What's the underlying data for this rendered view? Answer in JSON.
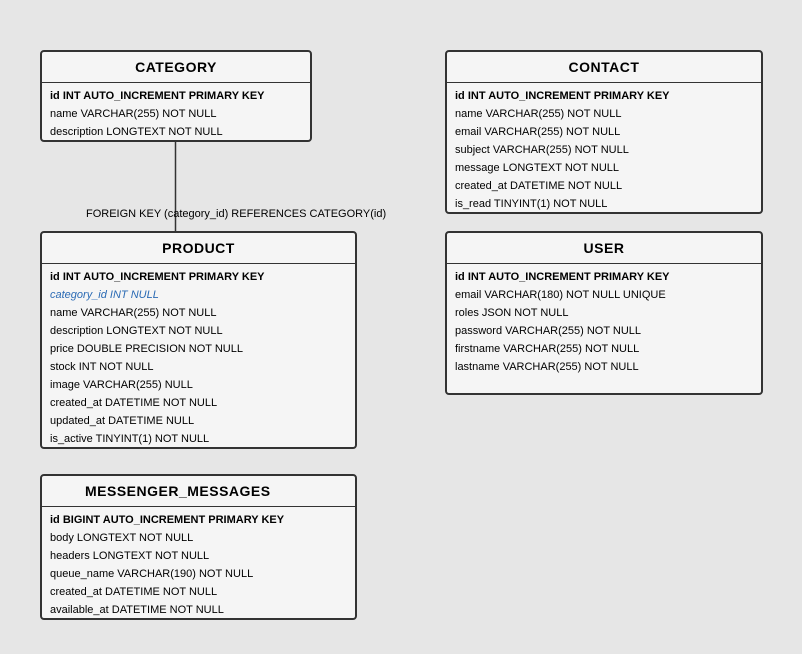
{
  "tables": {
    "category": {
      "name": "CATEGORY",
      "columns": [
        "id INT AUTO_INCREMENT PRIMARY KEY",
        "name VARCHAR(255) NOT NULL",
        "description LONGTEXT NOT NULL"
      ]
    },
    "contact": {
      "name": "CONTACT",
      "columns": [
        "id INT AUTO_INCREMENT PRIMARY KEY",
        "name VARCHAR(255) NOT NULL",
        "email VARCHAR(255) NOT NULL",
        "subject VARCHAR(255) NOT NULL",
        "message LONGTEXT NOT NULL",
        "created_at DATETIME NOT NULL",
        "is_read TINYINT(1) NOT NULL"
      ]
    },
    "product": {
      "name": "PRODUCT",
      "columns": [
        "id INT AUTO_INCREMENT PRIMARY KEY",
        "category_id INT NULL",
        "name VARCHAR(255) NOT NULL",
        "description LONGTEXT NOT NULL",
        "price DOUBLE PRECISION NOT NULL",
        "stock INT NOT NULL",
        "image VARCHAR(255) NULL",
        "created_at DATETIME NOT NULL",
        "updated_at DATETIME NULL",
        "is_active TINYINT(1) NOT NULL"
      ]
    },
    "user": {
      "name": "USER",
      "columns": [
        "id INT AUTO_INCREMENT PRIMARY KEY",
        "email VARCHAR(180) NOT NULL UNIQUE",
        "roles JSON NOT NULL",
        "password VARCHAR(255) NOT NULL",
        "firstname VARCHAR(255) NOT NULL",
        "lastname VARCHAR(255) NOT NULL"
      ]
    },
    "messenger_messages": {
      "name": "MESSENGER_MESSAGES",
      "columns": [
        "id BIGINT AUTO_INCREMENT PRIMARY KEY",
        "body LONGTEXT NOT NULL",
        "headers LONGTEXT NOT NULL",
        "queue_name VARCHAR(190) NOT NULL",
        "created_at DATETIME NOT NULL",
        "available_at DATETIME NOT NULL"
      ]
    }
  },
  "relations": [
    {
      "label": "FOREIGN KEY (category_id) REFERENCES CATEGORY(id)"
    }
  ],
  "colors": {
    "background": "#e6e6e6",
    "table_fill": "#f5f5f5",
    "border": "#333333",
    "foreign_key_text": "#2a6ab4"
  }
}
